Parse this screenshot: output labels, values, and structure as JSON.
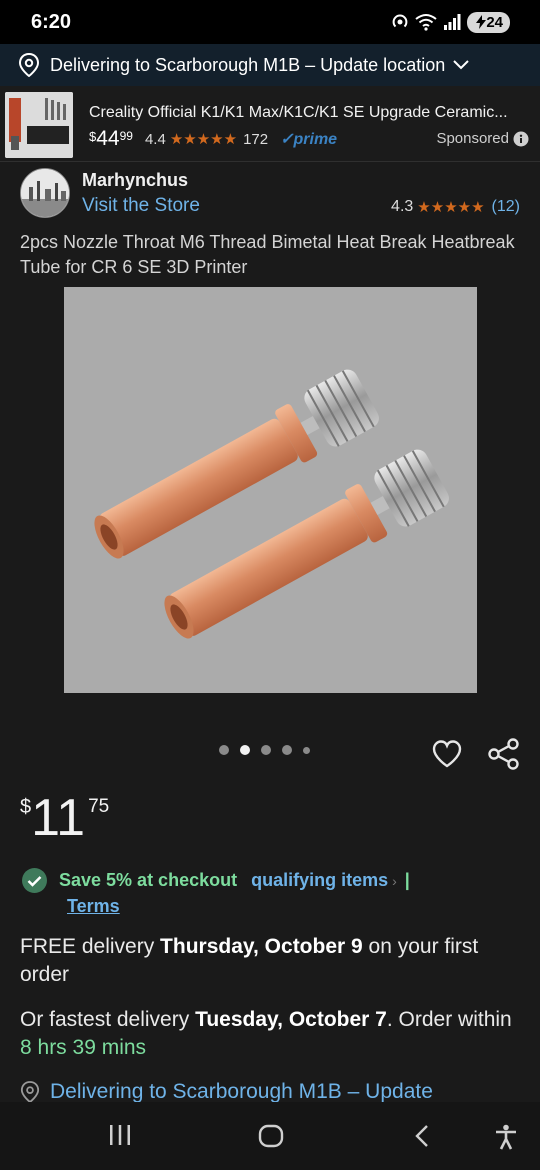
{
  "status_bar": {
    "time": "6:20",
    "battery": "24"
  },
  "location_bar": {
    "text": "Delivering to Scarborough M1B – Update location"
  },
  "ad": {
    "title": "Creality Official K1/K1 Max/K1C/K1 SE Upgrade Ceramic...",
    "price_symbol": "$",
    "price_whole": "44",
    "price_fraction": "99",
    "rating": "4.4",
    "stars": "★★★★★",
    "review_count": "172",
    "prime_label": "✓prime",
    "sponsored_label": "Sponsored"
  },
  "store": {
    "name": "Marhynchus",
    "visit_label": "Visit the Store",
    "rating": "4.3",
    "stars": "★★★★★",
    "review_count": "(12)"
  },
  "product": {
    "title": "2pcs Nozzle Throat M6 Thread Bimetal Heat Break Heatbreak Tube for CR 6 SE 3D Printer",
    "image_count": 5,
    "active_image_index": 1
  },
  "price": {
    "symbol": "$",
    "whole": "11",
    "fraction": "75"
  },
  "promo": {
    "save_text": "Save 5% at checkout",
    "qualifying_link": "qualifying items",
    "separator": "|",
    "terms_link": "Terms"
  },
  "delivery": {
    "prefix": "FREE delivery ",
    "date": "Thursday, October 9",
    "suffix": " on your first order"
  },
  "fastest": {
    "prefix": "Or fastest delivery ",
    "date": "Tuesday, October 7",
    "middle": ". Order within ",
    "timer": "8 hrs 39 mins"
  },
  "deliver_location": {
    "text": "Delivering to Scarborough M1B – Update"
  },
  "colors": {
    "background": "#1a1a1a",
    "link_blue": "#6fb3e8",
    "promo_green": "#7ddc9e",
    "star_orange": "#d2691e",
    "location_bar": "#13202c"
  }
}
